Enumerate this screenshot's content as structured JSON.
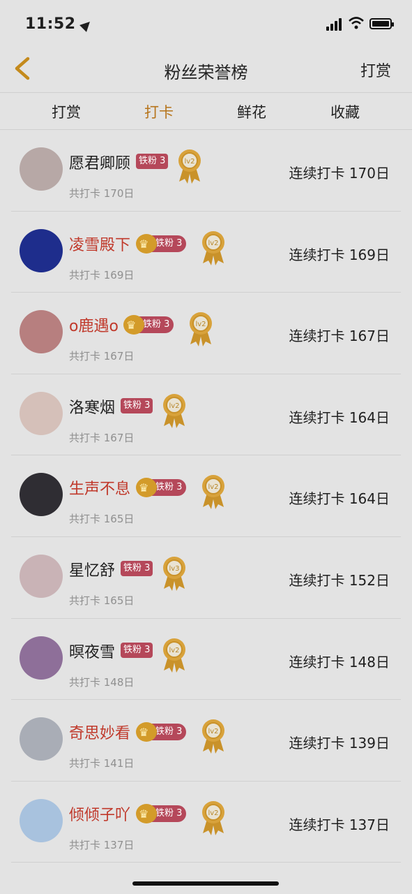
{
  "status": {
    "time": "11:52"
  },
  "nav": {
    "title": "粉丝荣誉榜",
    "right": "打赏"
  },
  "tabs": [
    {
      "label": "打赏"
    },
    {
      "label": "打卡",
      "active": true
    },
    {
      "label": "鲜花"
    },
    {
      "label": "收藏"
    }
  ],
  "fans": [
    {
      "name": "愿君卿顾",
      "vip": false,
      "fan_label": "铁粉 3",
      "level": "lv2",
      "total": "共打卡 170日",
      "streak": "连续打卡 170日",
      "avatar_color": "#b7a8a6"
    },
    {
      "name": "凌雪殿下",
      "vip": true,
      "fan_label": "铁粉 3",
      "level": "lv2",
      "total": "共打卡 169日",
      "streak": "连续打卡 169日",
      "avatar_color": "#1e2d8c"
    },
    {
      "name": "o鹿遇o",
      "vip": true,
      "fan_label": "铁粉 3",
      "level": "lv2",
      "total": "共打卡 167日",
      "streak": "连续打卡 167日",
      "avatar_color": "#b77f7f"
    },
    {
      "name": "洛寒烟",
      "vip": false,
      "fan_label": "铁粉 3",
      "level": "lv2",
      "total": "共打卡 167日",
      "streak": "连续打卡 164日",
      "avatar_color": "#d5c0b9"
    },
    {
      "name": "生声不息",
      "vip": true,
      "fan_label": "铁粉 3",
      "level": "lv2",
      "total": "共打卡 165日",
      "streak": "连续打卡 164日",
      "avatar_color": "#2f2d33"
    },
    {
      "name": "星忆舒",
      "vip": false,
      "fan_label": "铁粉 3",
      "level": "lv3",
      "total": "共打卡 165日",
      "streak": "连续打卡 152日",
      "avatar_color": "#c9b3b6"
    },
    {
      "name": "暝夜雪",
      "vip": false,
      "fan_label": "铁粉 3",
      "level": "lv2",
      "total": "共打卡 148日",
      "streak": "连续打卡 148日",
      "avatar_color": "#8e6f99"
    },
    {
      "name": "奇思妙看",
      "vip": true,
      "fan_label": "铁粉 3",
      "level": "lv2",
      "total": "共打卡 141日",
      "streak": "连续打卡 139日",
      "avatar_color": "#a9adb6"
    },
    {
      "name": "倾倾子吖",
      "vip": true,
      "fan_label": "铁粉 3",
      "level": "lv2",
      "total": "共打卡 137日",
      "streak": "连续打卡 137日",
      "avatar_color": "#a8c2de"
    }
  ]
}
